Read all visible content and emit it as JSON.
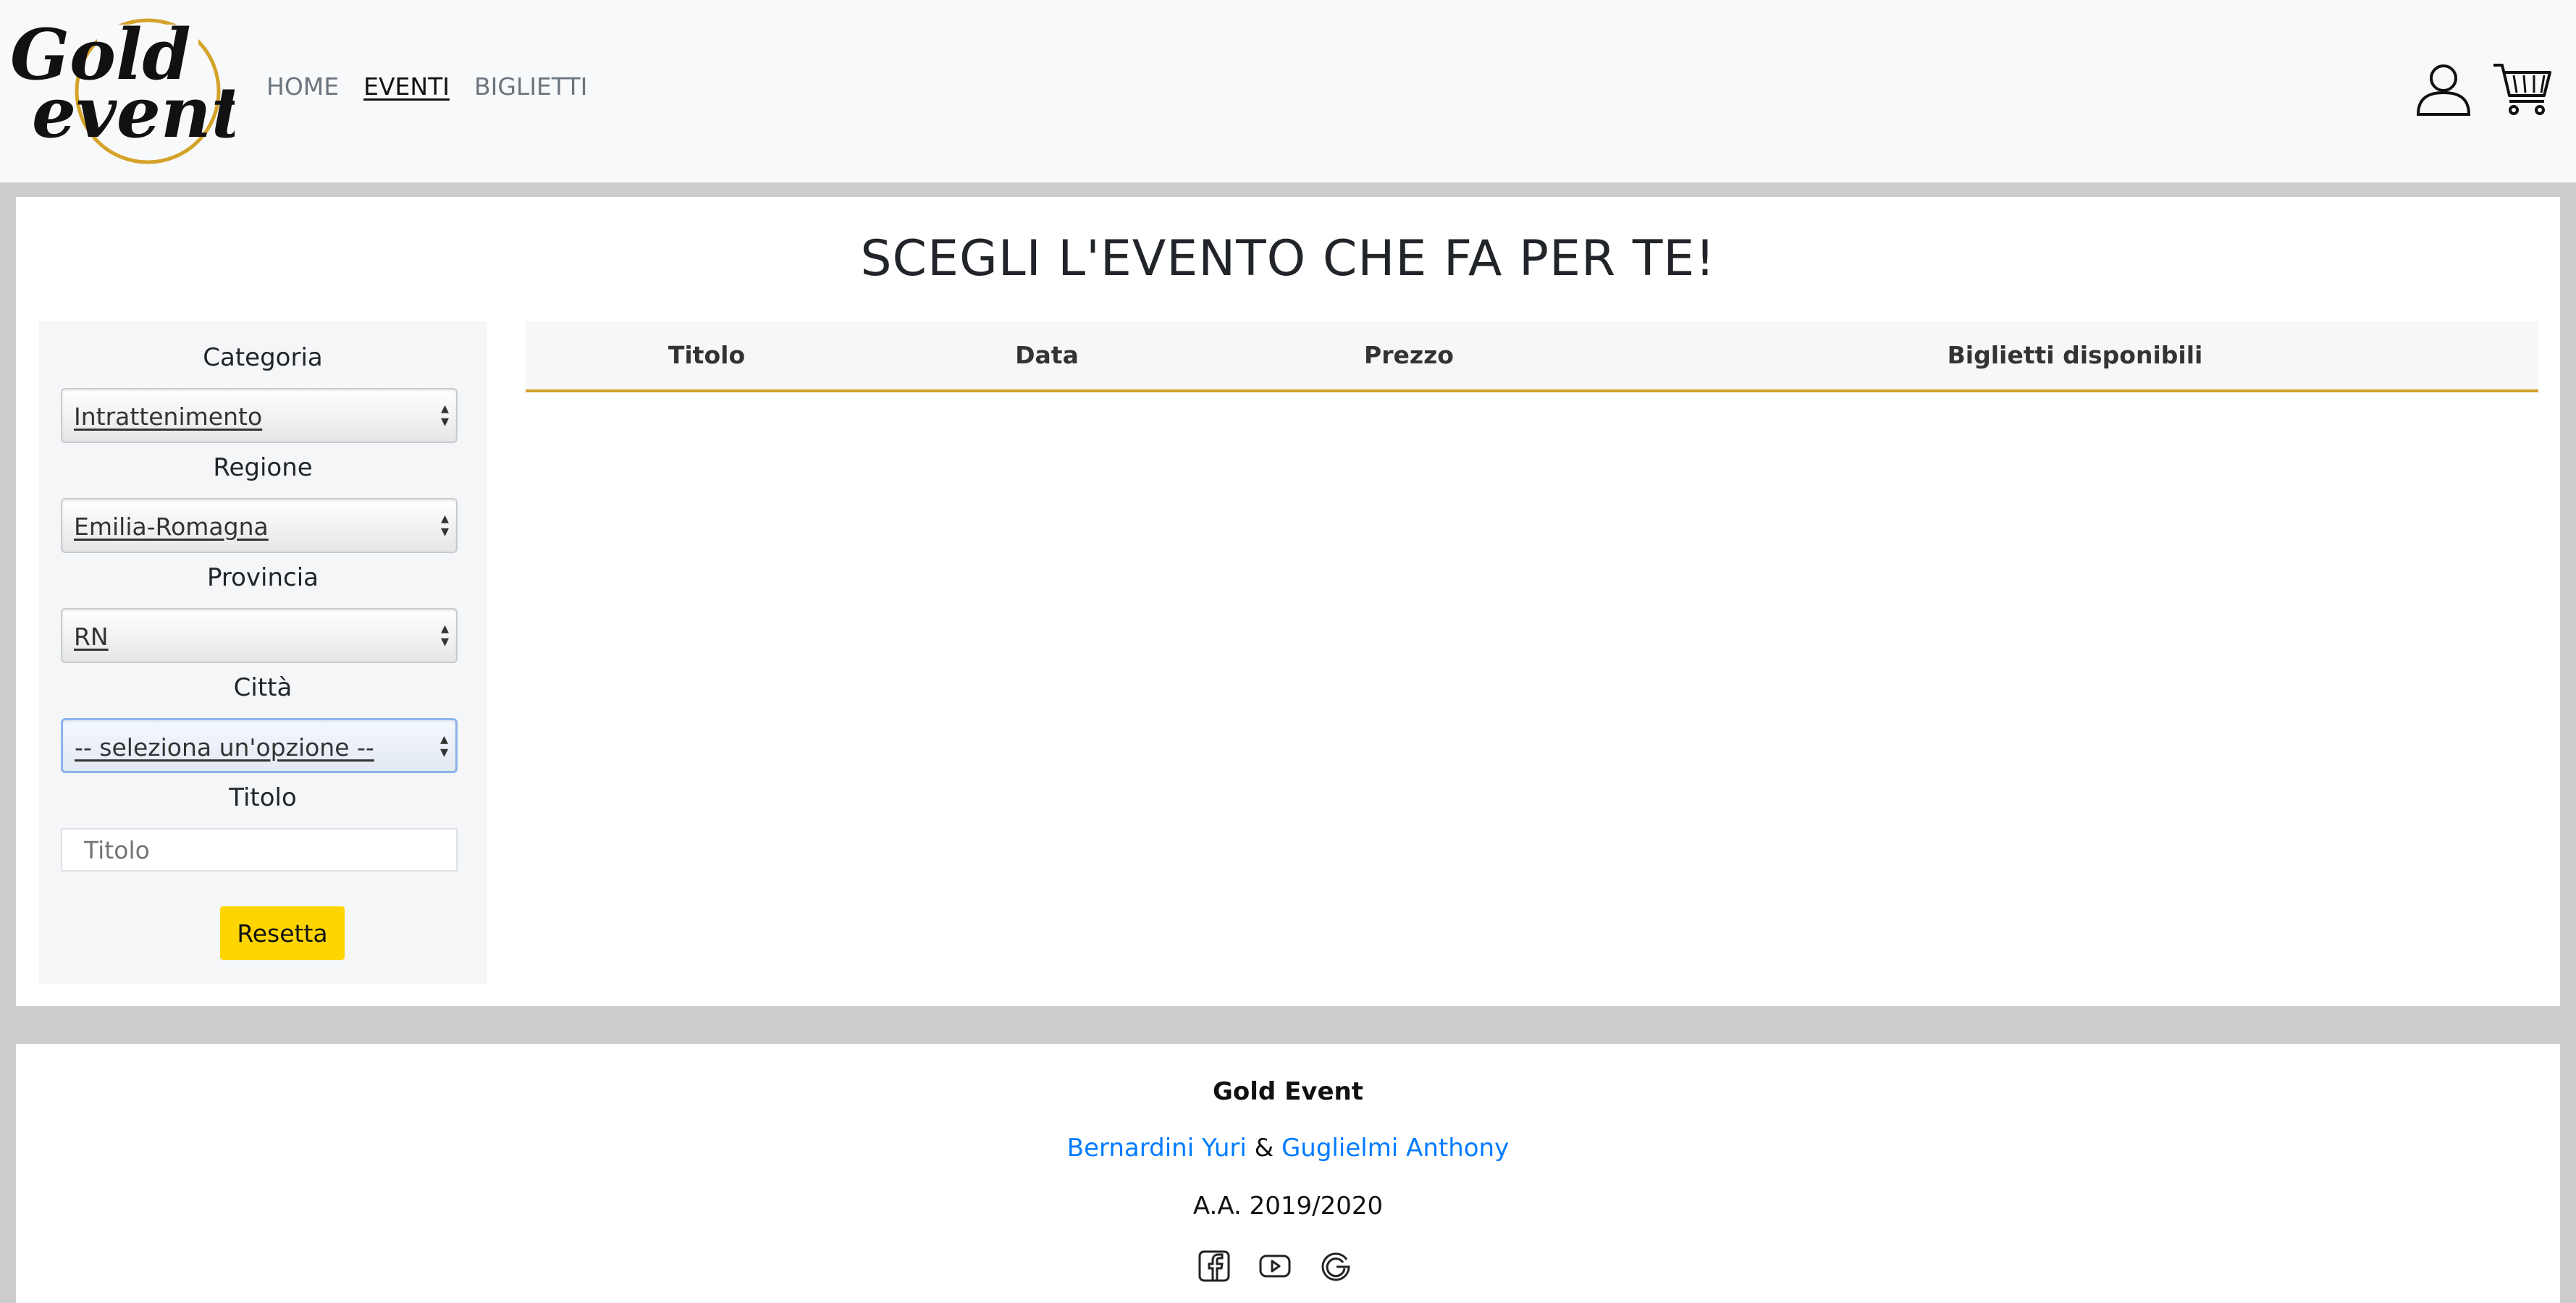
{
  "navbar": {
    "logo": {
      "line1": "Gold",
      "line2": "event",
      "ring_color": "#d4a32a"
    },
    "links": [
      {
        "label": "HOME",
        "active": false
      },
      {
        "label": "EVENTI",
        "active": true
      },
      {
        "label": "BIGLIETTI",
        "active": false
      }
    ],
    "icons": [
      "user-icon",
      "cart-icon"
    ]
  },
  "main": {
    "title": "SCEGLI L'EVENTO CHE FA PER TE!",
    "filters": {
      "categoria_label": "Categoria",
      "categoria_value": "Intrattenimento",
      "regione_label": "Regione",
      "regione_value": "Emilia-Romagna",
      "provincia_label": "Provincia",
      "provincia_value": "RN",
      "citta_label": "Città",
      "citta_value": "-- seleziona un'opzione --",
      "titolo_label": "Titolo",
      "titolo_placeholder": "Titolo",
      "reset_label": "Resetta"
    },
    "table": {
      "headers": [
        "Titolo",
        "Data",
        "Prezzo",
        "Biglietti disponibili"
      ],
      "rows": []
    }
  },
  "footer": {
    "title": "Gold Event",
    "author1": "Bernardini Yuri",
    "separator": "&",
    "author2": "Guglielmi Anthony",
    "year": "A.A. 2019/2020",
    "social_icons": [
      "facebook-icon",
      "youtube-icon",
      "google-icon"
    ]
  },
  "colors": {
    "accent": "#d4a32a",
    "button": "#ffd500",
    "link": "#007bff",
    "page_bg": "#cccccc"
  }
}
